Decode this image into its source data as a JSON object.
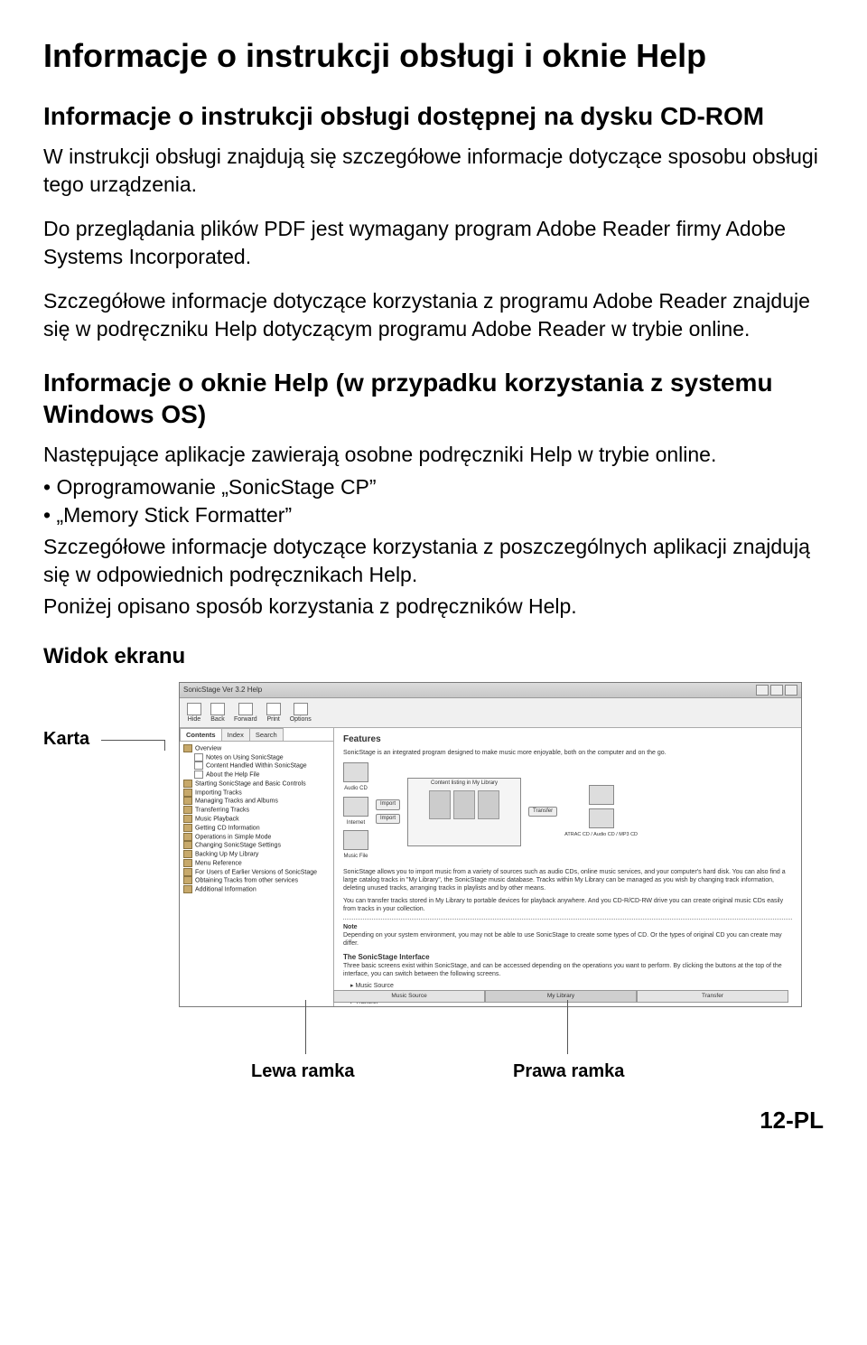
{
  "page": {
    "title": "Informacje o instrukcji obsługi i oknie Help",
    "number": "12-PL"
  },
  "section1": {
    "heading": "Informacje o instrukcji obsługi dostępnej na dysku CD-ROM",
    "para1": "W instrukcji obsługi znajdują się szczegółowe informacje dotyczące sposobu obsługi tego urządzenia.",
    "para2": "Do przeglądania plików PDF jest wymagany program Adobe Reader firmy Adobe Systems Incorporated.",
    "para3": "Szczegółowe informacje dotyczące korzystania z programu Adobe Reader znajduje się w podręczniku Help dotyczącym programu Adobe Reader w trybie online."
  },
  "section2": {
    "heading": "Informacje o oknie Help (w przypadku korzystania z systemu Windows OS)",
    "intro": "Następujące aplikacje zawierają osobne podręczniki Help w trybie online.",
    "bullet1": "• Oprogramowanie „SonicStage CP”",
    "bullet2": "• „Memory Stick Formatter”",
    "detail": "Szczegółowe informacje dotyczące korzystania z poszczególnych aplikacji znajdują się w odpowiednich podręcznikach Help.",
    "below": "Poniżej opisano sposób korzystania z podręczników Help."
  },
  "figure": {
    "sectionLabel": "Widok ekranu",
    "kartaLabel": "Karta",
    "lewaLabel": "Lewa ramka",
    "prawaLabel": "Prawa ramka"
  },
  "helpWindow": {
    "title": "SonicStage Ver 3.2 Help",
    "toolbar": {
      "hide": "Hide",
      "back": "Back",
      "forward": "Forward",
      "print": "Print",
      "options": "Options"
    },
    "tabs": {
      "contents": "Contents",
      "index": "Index",
      "search": "Search"
    },
    "tree": [
      "Overview",
      "Notes on Using SonicStage",
      "Content Handled Within SonicStage",
      "About the Help File",
      "Starting SonicStage and Basic Controls",
      "Importing Tracks",
      "Managing Tracks and Albums",
      "Transferring Tracks",
      "Music Playback",
      "Getting CD Information",
      "Operations in Simple Mode",
      "Changing SonicStage Settings",
      "Backing Up My Library",
      "Menu Reference",
      "For Users of Earlier Versions of SonicStage",
      "Obtaining Tracks from other services",
      "Additional Information"
    ],
    "content": {
      "heading": "Features",
      "lead": "SonicStage is an integrated program designed to make music more enjoyable, both on the computer and on the go.",
      "diag": {
        "center": "Content listing in My Library",
        "leftBtns": [
          "Import",
          "Import"
        ],
        "leftIcons": [
          "Audio CD",
          "Internet",
          "Music File"
        ],
        "rightBtn": "Transfer",
        "rightIcon": "ATRAC CD / Audio CD / MP3 CD"
      },
      "body1": "SonicStage allows you to import music from a variety of sources such as audio CDs, online music services, and your computer's hard disk. You can also find a large catalog tracks in \"My Library\", the SonicStage music database. Tracks within My Library can be managed as you wish by changing track information, deleting unused tracks, arranging tracks in playlists and by other means.",
      "body2": "You can transfer tracks stored in My Library to portable devices for playback anywhere. And you CD-R/CD-RW drive you can create original music CDs easily from tracks in your collection.",
      "noteLabel": "Note",
      "note": "Depending on your system environment, you may not be able to use SonicStage to create some types of CD. Or the types of original CD you can create may differ.",
      "sub": "The SonicStage Interface",
      "sub1": "Three basic screens exist within SonicStage, and can be accessed depending on the operations you want to perform. By clicking the buttons at the top of the interface, you can switch between the following screens.",
      "li1": "Music Source",
      "li2": "My Library",
      "li3": "Transfer"
    },
    "bottomTabs": {
      "t1": "Music Source",
      "t2": "My Library",
      "t3": "Transfer"
    }
  }
}
